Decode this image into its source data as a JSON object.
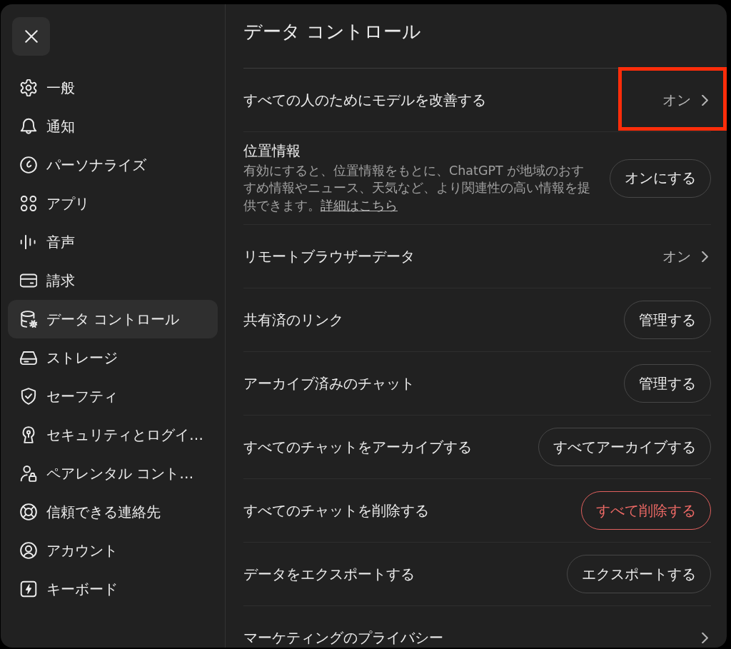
{
  "sidebar": {
    "items": [
      {
        "label": "一般",
        "selected": false
      },
      {
        "label": "通知",
        "selected": false
      },
      {
        "label": "パーソナライズ",
        "selected": false
      },
      {
        "label": "アプリ",
        "selected": false
      },
      {
        "label": "音声",
        "selected": false
      },
      {
        "label": "請求",
        "selected": false
      },
      {
        "label": "データ コントロール",
        "selected": true
      },
      {
        "label": "ストレージ",
        "selected": false
      },
      {
        "label": "セーフティ",
        "selected": false
      },
      {
        "label": "セキュリティとログイ…",
        "selected": false
      },
      {
        "label": "ペアレンタル コント…",
        "selected": false
      },
      {
        "label": "信頼できる連絡先",
        "selected": false
      },
      {
        "label": "アカウント",
        "selected": false
      },
      {
        "label": "キーボード",
        "selected": false
      }
    ]
  },
  "content": {
    "title": "データ コントロール",
    "rows": [
      {
        "kind": "link",
        "label": "すべての人のためにモデルを改善する",
        "value": "オン",
        "highlighted": true,
        "danger": false
      },
      {
        "kind": "button",
        "label": "位置情報",
        "description": "有効にすると、位置情報をもとに、ChatGPT が地域のおすすめ情報やニュース、天気など、より関連性の高い情報を提供できます。",
        "link": "詳細はこちら",
        "button": "オンにする",
        "highlighted": false,
        "danger": false
      },
      {
        "kind": "link",
        "label": "リモートブラウザーデータ",
        "value": "オン",
        "highlighted": false,
        "danger": false
      },
      {
        "kind": "button",
        "label": "共有済のリンク",
        "button": "管理する",
        "highlighted": false,
        "danger": false
      },
      {
        "kind": "button",
        "label": "アーカイブ済みのチャット",
        "button": "管理する",
        "highlighted": false,
        "danger": false
      },
      {
        "kind": "button",
        "label": "すべてのチャットをアーカイブする",
        "button": "すべてアーカイブする",
        "highlighted": false,
        "danger": false
      },
      {
        "kind": "button",
        "label": "すべてのチャットを削除する",
        "button": "すべて削除する",
        "highlighted": false,
        "danger": true
      },
      {
        "kind": "button",
        "label": "データをエクスポートする",
        "button": "エクスポートする",
        "highlighted": false,
        "danger": false
      },
      {
        "kind": "link",
        "label": "マーケティングのプライバシー",
        "highlighted": false,
        "danger": false
      }
    ]
  }
}
